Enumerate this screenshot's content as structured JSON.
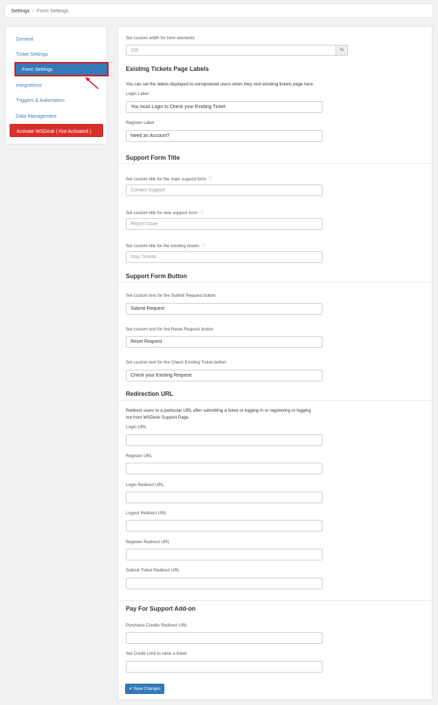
{
  "breadcrumb": {
    "root": "Settings",
    "separator": "/",
    "current": "Form Settings"
  },
  "sidebar": {
    "items": [
      {
        "label": "General"
      },
      {
        "label": "Ticket Settings"
      },
      {
        "label": "Form Settings"
      },
      {
        "label": "Integrations"
      },
      {
        "label": "Triggers & Automation"
      },
      {
        "label": "Data Management"
      }
    ],
    "activate_label": "Activate WSDesk ( Not Activated )"
  },
  "form_width": {
    "label": "Set custom width for form elements",
    "placeholder": "100",
    "unit": "%"
  },
  "existing_labels": {
    "heading": "Existing Tickets Page Labels",
    "description": "You can set the labels displayed to unregistered users when they visit exisiting tickets page here.",
    "login_label": "Login Label",
    "login_value": "You must Login to Check your Existing Ticket",
    "register_label": "Register Label",
    "register_value": "Need an Account?"
  },
  "support_title": {
    "heading": "Support Form Title",
    "main_label": "Set custom title for the main support form",
    "main_placeholder": "Contact Support",
    "new_label": "Set custom title for new support form",
    "new_placeholder": "Report Issue",
    "existing_label": "Set custom title for the existing tickets",
    "existing_placeholder": "Your Tickets",
    "info_icon": "ⓘ"
  },
  "support_button": {
    "heading": "Support Form Button",
    "submit_label": "Set custom text for the Submit Request button",
    "submit_value": "Submit Request",
    "reset_label": "Set custom text for the Reset Request button",
    "reset_value": "Reset Request",
    "check_label": "Set custom text for the Check Existing Ticket button",
    "check_value": "Check your Existing Request"
  },
  "redirection": {
    "heading": "Redirection URL",
    "description_line1": "Redirect users to a particular URL after submitting a ticket or logging in or registering or logging",
    "description_line2": "out from WSDesk Support Page.",
    "login_url": "Login URL",
    "register_url": "Register URL",
    "login_redirect": "Login Redirect URL",
    "logout_redirect": "Logout Redirect URL",
    "register_redirect": "Register Redirect URL",
    "submit_redirect": "Submit Ticket Redirect URL"
  },
  "pay_support": {
    "heading": "Pay For Support Add-on",
    "purchase_label": "Purchase-Credits Redirect URL",
    "credit_label": "Set Credit Limit to raise a ticket"
  },
  "save_label": "Save Changes",
  "colors": {
    "accent": "#337ab7",
    "danger": "#d9302b",
    "highlight": "#e0161b"
  }
}
